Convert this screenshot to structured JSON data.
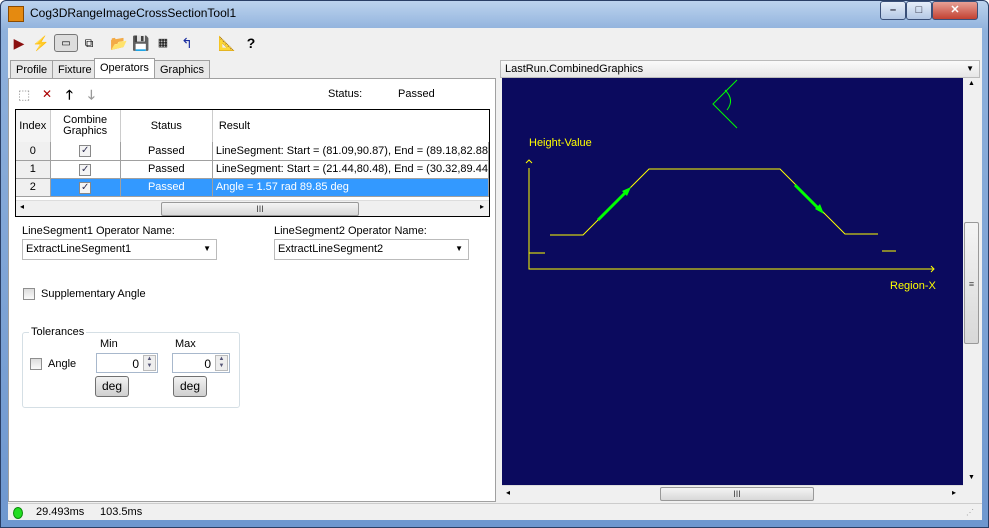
{
  "window": {
    "title": "Cog3DRangeImageCrossSectionTool1",
    "controls": [
      "minimize",
      "maximize",
      "close"
    ]
  },
  "toolbar": {
    "icons": [
      "run-icon",
      "electric-icon",
      "show-image-icon",
      "floating-icon",
      "open-icon",
      "save-icon",
      "save-as-icon",
      "reset-icon",
      "measure-icon",
      "help-icon"
    ]
  },
  "tabs": [
    {
      "label": "Profile"
    },
    {
      "label": "Fixture"
    },
    {
      "label": "Operators"
    },
    {
      "label": "Graphics"
    }
  ],
  "operators": {
    "status_label": "Status:",
    "status_value": "Passed",
    "columns": [
      "Index",
      "Combine Graphics",
      "Status",
      "Result"
    ],
    "rows": [
      {
        "index": "0",
        "combine": true,
        "status": "Passed",
        "result": "LineSegment: Start = (81.09,90.87), End = (89.18,82.88"
      },
      {
        "index": "1",
        "combine": true,
        "status": "Passed",
        "result": "LineSegment: Start = (21.44,80.48), End = (30.32,89.44"
      },
      {
        "index": "2",
        "combine": true,
        "status": "Passed",
        "result": "Angle = 1.57 rad 89.85 deg",
        "selected": true
      }
    ],
    "scroll_grip": "III",
    "ls1_label": "LineSegment1 Operator Name:",
    "ls1_value": "ExtractLineSegment1",
    "ls2_label": "LineSegment2 Operator Name:",
    "ls2_value": "ExtractLineSegment2",
    "supplementary_label": "Supplementary Angle",
    "supplementary_checked": false,
    "tolerances": {
      "legend": "Tolerances",
      "min_label": "Min",
      "max_label": "Max",
      "angle_label": "Angle",
      "angle_checked": false,
      "min_value": "0",
      "max_value": "0",
      "min_unit": "deg",
      "max_unit": "deg"
    }
  },
  "display": {
    "selector": "LastRun.CombinedGraphics",
    "y_label": "Height-Value",
    "x_label": "Region-X",
    "colors": {
      "background": "#0b0a5e",
      "profile": "#ffff00",
      "segments": "#00ff00"
    },
    "scroll_grip": "III"
  },
  "statusbar": {
    "status_color": "#22dd22",
    "time1": "29.493ms",
    "time2": "103.5ms"
  }
}
